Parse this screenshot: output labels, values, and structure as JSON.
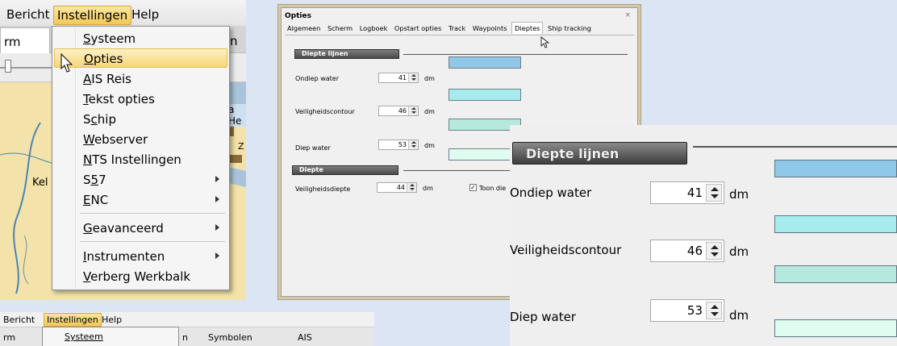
{
  "menu_panel": {
    "menubar": [
      "Bericht",
      "Instellingen",
      "Help"
    ],
    "tab_partial": "rm",
    "tab_right_partial": "n",
    "map_labels": {
      "kel": "Kel",
      "he": "a He",
      "z": "Z"
    },
    "menu_items": [
      {
        "label": "Systeem",
        "u": "S",
        "rest": "ysteem"
      },
      {
        "label": "Opties",
        "u": "O",
        "rest": "pties"
      },
      {
        "label": "AIS Reis",
        "u": "A",
        "rest": "IS Reis"
      },
      {
        "label": "Tekst opties",
        "u": "T",
        "rest": "ekst opties"
      },
      {
        "label": "Schip",
        "pre": "S",
        "u": "c",
        "rest": "hip"
      },
      {
        "label": "Webserver",
        "u": "W",
        "rest": "ebserver"
      },
      {
        "label": "NTS Instellingen",
        "u": "N",
        "rest": "TS Instellingen"
      },
      {
        "label": "S57",
        "pre": "S",
        "u": "5",
        "rest": "7"
      },
      {
        "label": "ENC",
        "u": "E",
        "rest": "NC"
      },
      {
        "label": "Geavanceerd",
        "u": "G",
        "rest": "eavanceerd"
      },
      {
        "label": "Instrumenten",
        "u": "I",
        "rest": "nstrumenten"
      },
      {
        "label": "Verberg Werkbalk",
        "u": "V",
        "rest": "erberg Werkbalk"
      }
    ]
  },
  "dialog": {
    "title": "Opties",
    "close": "×",
    "tabs": [
      "Algemeen",
      "Scherm",
      "Logboek",
      "Opstart opties",
      "Track",
      "Waypoints",
      "Dieptes",
      "Ship tracking"
    ],
    "active_tab": "Dieptes",
    "group_lines": "Diepte lijnen",
    "group_depth": "Diepte",
    "rows": [
      {
        "label": "Ondiep water",
        "value": "41",
        "unit": "dm"
      },
      {
        "label": "Veiligheidscontour",
        "value": "46",
        "unit": "dm"
      },
      {
        "label": "Diep water",
        "value": "53",
        "unit": "dm"
      }
    ],
    "safety": {
      "label": "Veiligheidsdiepte",
      "value": "44",
      "unit": "dm"
    },
    "checkbox_label": "Toon die",
    "checkbox_mark": "✓",
    "swatch_colors": [
      "#8fc8e8",
      "#a6ecec",
      "#b5e9dd",
      "#dffcf1"
    ]
  },
  "zoom": {
    "group_title": "Diepte lijnen",
    "rows": [
      {
        "label": "Ondiep water",
        "value": "41",
        "unit": "dm"
      },
      {
        "label": "Veiligheidscontour",
        "value": "46",
        "unit": "dm"
      },
      {
        "label": "Diep water",
        "value": "53",
        "unit": "dm"
      }
    ],
    "swatch_colors": [
      "#8fc8e8",
      "#a6ecec",
      "#b5e9dd",
      "#dffcf1"
    ]
  },
  "strip": {
    "menubar": [
      "Bericht",
      "Instellingen",
      "Help"
    ],
    "tabs": [
      "rm",
      "n",
      "Symbolen",
      "AIS"
    ],
    "dropdown_first": "Systeem"
  }
}
